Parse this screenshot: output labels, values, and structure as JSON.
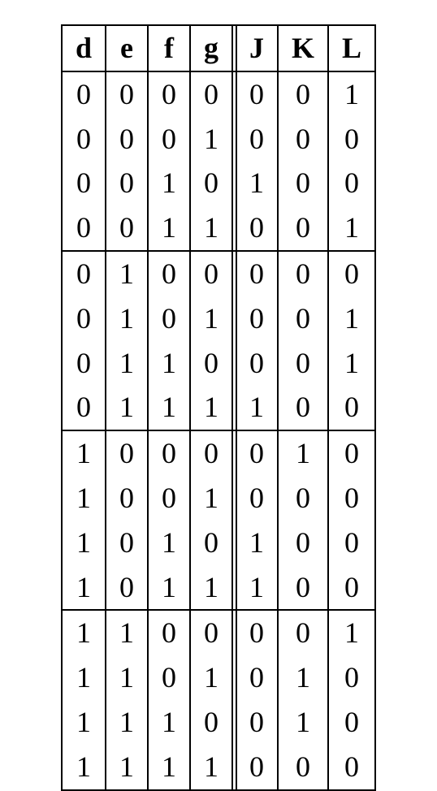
{
  "table": {
    "headers": [
      "d",
      "e",
      "f",
      "g",
      "J",
      "K",
      "L"
    ],
    "rows": [
      {
        "d": "0",
        "e": "0",
        "f": "0",
        "g": "0",
        "J": "0",
        "K": "0",
        "L": "1"
      },
      {
        "d": "0",
        "e": "0",
        "f": "0",
        "g": "1",
        "J": "0",
        "K": "0",
        "L": "0"
      },
      {
        "d": "0",
        "e": "0",
        "f": "1",
        "g": "0",
        "J": "1",
        "K": "0",
        "L": "0"
      },
      {
        "d": "0",
        "e": "0",
        "f": "1",
        "g": "1",
        "J": "0",
        "K": "0",
        "L": "1"
      },
      {
        "d": "0",
        "e": "1",
        "f": "0",
        "g": "0",
        "J": "0",
        "K": "0",
        "L": "0"
      },
      {
        "d": "0",
        "e": "1",
        "f": "0",
        "g": "1",
        "J": "0",
        "K": "0",
        "L": "1"
      },
      {
        "d": "0",
        "e": "1",
        "f": "1",
        "g": "0",
        "J": "0",
        "K": "0",
        "L": "1"
      },
      {
        "d": "0",
        "e": "1",
        "f": "1",
        "g": "1",
        "J": "1",
        "K": "0",
        "L": "0"
      },
      {
        "d": "1",
        "e": "0",
        "f": "0",
        "g": "0",
        "J": "0",
        "K": "1",
        "L": "0"
      },
      {
        "d": "1",
        "e": "0",
        "f": "0",
        "g": "1",
        "J": "0",
        "K": "0",
        "L": "0"
      },
      {
        "d": "1",
        "e": "0",
        "f": "1",
        "g": "0",
        "J": "1",
        "K": "0",
        "L": "0"
      },
      {
        "d": "1",
        "e": "0",
        "f": "1",
        "g": "1",
        "J": "1",
        "K": "0",
        "L": "0"
      },
      {
        "d": "1",
        "e": "1",
        "f": "0",
        "g": "0",
        "J": "0",
        "K": "0",
        "L": "1"
      },
      {
        "d": "1",
        "e": "1",
        "f": "0",
        "g": "1",
        "J": "0",
        "K": "1",
        "L": "0"
      },
      {
        "d": "1",
        "e": "1",
        "f": "1",
        "g": "0",
        "J": "0",
        "K": "1",
        "L": "0"
      },
      {
        "d": "1",
        "e": "1",
        "f": "1",
        "g": "1",
        "J": "0",
        "K": "0",
        "L": "0"
      }
    ],
    "group_ends": [
      3,
      7,
      11,
      15
    ]
  }
}
